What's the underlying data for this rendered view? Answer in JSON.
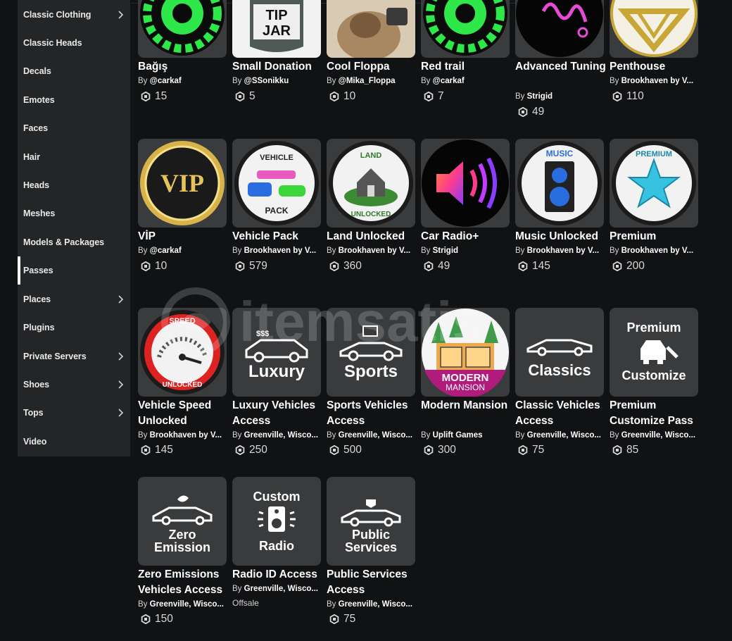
{
  "sidebar": {
    "items": [
      {
        "label": "Classic Clothing",
        "chevron": true,
        "active": false
      },
      {
        "label": "Classic Heads",
        "chevron": false,
        "active": false
      },
      {
        "label": "Decals",
        "chevron": false,
        "active": false
      },
      {
        "label": "Emotes",
        "chevron": false,
        "active": false
      },
      {
        "label": "Faces",
        "chevron": false,
        "active": false
      },
      {
        "label": "Hair",
        "chevron": false,
        "active": false
      },
      {
        "label": "Heads",
        "chevron": false,
        "active": false
      },
      {
        "label": "Meshes",
        "chevron": false,
        "active": false
      },
      {
        "label": "Models & Packages",
        "chevron": false,
        "active": false
      },
      {
        "label": "Passes",
        "chevron": false,
        "active": true
      },
      {
        "label": "Places",
        "chevron": true,
        "active": false
      },
      {
        "label": "Plugins",
        "chevron": false,
        "active": false
      },
      {
        "label": "Private Servers",
        "chevron": true,
        "active": false
      },
      {
        "label": "Shoes",
        "chevron": true,
        "active": false
      },
      {
        "label": "Tops",
        "chevron": true,
        "active": false
      },
      {
        "label": "Video",
        "chevron": false,
        "active": false
      }
    ]
  },
  "by_prefix": "By",
  "items": [
    {
      "name": "Bağış",
      "creator": "@carkaf",
      "price": "15",
      "icon": "green-gear-logo-icon",
      "thumb_text": ""
    },
    {
      "name": "Small Donation",
      "creator": "@SSonikku",
      "price": "5",
      "icon": "tip-jar-icon",
      "thumb_text": "TIP JAR"
    },
    {
      "name": "Cool Floppa",
      "creator": "@Mika_Floppa",
      "price": "10",
      "icon": "cat-photo-icon",
      "thumb_text": ""
    },
    {
      "name": "Red trail",
      "creator": "@carkaf",
      "price": "7",
      "icon": "green-gear-logo-icon",
      "thumb_text": ""
    },
    {
      "name": "Advanced Tuning",
      "creator": "Strigid",
      "price": "49",
      "icon": "neon-spring-icon",
      "thumb_text": ""
    },
    {
      "name": "Penthouse",
      "creator": "Brookhaven by V...",
      "price": "110",
      "icon": "gold-diamond-icon",
      "thumb_text": ""
    },
    {
      "name": "VİP",
      "creator": "@carkaf",
      "price": "10",
      "icon": "vip-badge-icon",
      "thumb_text": "VIP"
    },
    {
      "name": "Vehicle Pack",
      "creator": "Brookhaven by V...",
      "price": "579",
      "icon": "vehicle-pack-icon",
      "thumb_text": "VEHICLE PACK"
    },
    {
      "name": "Land Unlocked",
      "creator": "Brookhaven by V...",
      "price": "360",
      "icon": "land-house-icon",
      "thumb_text": "LAND UNLOCKED"
    },
    {
      "name": "Car Radio+",
      "creator": "Strigid",
      "price": "49",
      "icon": "speaker-sound-icon",
      "thumb_text": ""
    },
    {
      "name": "Music Unlocked",
      "creator": "Brookhaven by V...",
      "price": "145",
      "icon": "music-speaker-icon",
      "thumb_text": "MUSIC"
    },
    {
      "name": "Premium",
      "creator": "Brookhaven by V...",
      "price": "200",
      "icon": "premium-star-icon",
      "thumb_text": "PREMIUM"
    },
    {
      "name": "Vehicle Speed Unlocked",
      "creator": "Brookhaven by V...",
      "price": "145",
      "icon": "speedometer-icon",
      "thumb_text": "SPEED UNLOCKED"
    },
    {
      "name": "Luxury Vehicles Access",
      "creator": "Greenville, Wisco...",
      "price": "250",
      "icon": "luxury-car-icon",
      "thumb_text": "Luxury"
    },
    {
      "name": "Sports Vehicles Access",
      "creator": "Greenville, Wisco...",
      "price": "500",
      "icon": "sports-car-icon",
      "thumb_text": "Sports"
    },
    {
      "name": "Modern Mansion",
      "creator": "Uplift Games",
      "price": "300",
      "icon": "modern-mansion-icon",
      "thumb_text": "MODERN MANSION"
    },
    {
      "name": "Classic Vehicles Access",
      "creator": "Greenville, Wisco...",
      "price": "75",
      "icon": "classic-car-icon",
      "thumb_text": "Classics"
    },
    {
      "name": "Premium Customize Pass",
      "creator": "Greenville, Wisco...",
      "price": "85",
      "icon": "customize-car-icon",
      "thumb_text": "Premium Customize"
    },
    {
      "name": "Zero Emissions Vehicles Access",
      "creator": "Greenville, Wisco...",
      "price": "150",
      "icon": "electric-car-icon",
      "thumb_text": "Zero Emission"
    },
    {
      "name": "Radio ID Access",
      "creator": "Greenville, Wisco...",
      "price": "",
      "offsale": "Offsale",
      "icon": "custom-radio-icon",
      "thumb_text": "Custom Radio"
    },
    {
      "name": "Public Services Access",
      "creator": "Greenville, Wisco...",
      "price": "75",
      "icon": "police-car-icon",
      "thumb_text": "Public Services"
    }
  ],
  "watermark": "itemsatis",
  "colors": {
    "background": "#111214",
    "sidebar": "#232527",
    "tile": "#393b3d",
    "neon_green": "#2ee84a"
  }
}
